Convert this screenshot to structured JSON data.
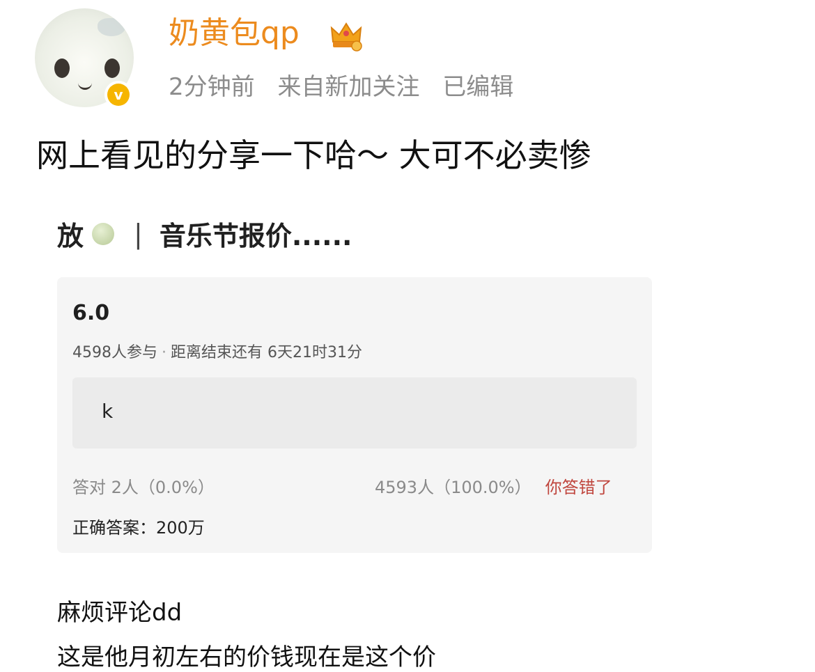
{
  "post": {
    "author": {
      "name": "奶黄包qp",
      "avatar_icon": "cat-plush-avatar",
      "verified_icon": "verified-badge-icon",
      "verified_glyph": "v",
      "badge_icon": "crown-member-icon"
    },
    "meta": {
      "time": "2分钟前",
      "source": "来自新加关注",
      "edited": "已编辑"
    },
    "text": "网上看见的分享一下哈～ 大可不必卖惨"
  },
  "screenshot": {
    "title_prefix": "放",
    "separator": "|",
    "title": "音乐节报价......",
    "quiz": {
      "question": "6.0",
      "participants": "4598人参与",
      "dot": "·",
      "countdown": "距离结束还有 6天21时31分",
      "answer": "k",
      "correct_stat": "答对  2人（0.0%）",
      "wrong_stat": "4593人（100.0%）",
      "wrong_label": "你答错了",
      "correct_answer": "正确答案：200万"
    },
    "caption1": "麻烦评论dd",
    "caption2": "这是他月初左右的价钱现在是这个价"
  },
  "colors": {
    "username": "#ec8b1e",
    "meta": "#8c8c8c",
    "verified": "#f6b500",
    "wrong": "#c0463e"
  }
}
